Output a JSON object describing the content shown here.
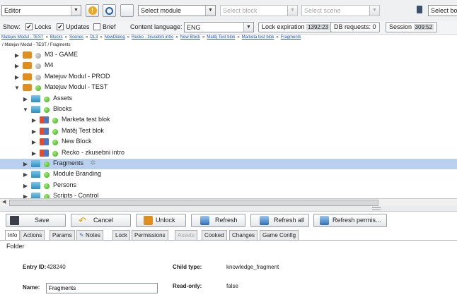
{
  "toolbar": {
    "mode_select": "Editor",
    "module_select": "Select module",
    "block_select": "Select block",
    "scene_select": "Select scene",
    "block_right_button": "Select bo"
  },
  "options": {
    "show_label": "Show:",
    "locks_label": "Locks",
    "locks_checked": true,
    "updates_label": "Updates",
    "updates_checked": true,
    "brief_label": "Brief",
    "brief_checked": false,
    "content_language_label": "Content language:",
    "content_language_value": "ENG",
    "lock_expiration_label": "Lock expiration",
    "lock_expiration_value": "1392:23",
    "db_requests_label": "DB requests:",
    "db_requests_value": "0",
    "session_label": "Session",
    "session_value": "309:52"
  },
  "breadcrumb": [
    "Matejuv Modul - TEST",
    "Blocks",
    "Scenes",
    "DL3",
    "NewDialog",
    "Recko - zkusebni intro",
    "New Block",
    "Matěj Test blok",
    "Marketa test blok",
    "Fragments"
  ],
  "breadcrumb_sep": "»",
  "path_text": "/  Matejuv Modul - TEST  /  Fragments",
  "tree": [
    {
      "label": "M3 - GAME",
      "toggle": "▶",
      "icon": "lock-icon",
      "dot": "grey"
    },
    {
      "label": "M4",
      "toggle": "▶",
      "icon": "lock-icon",
      "dot": "grey"
    },
    {
      "label": "Matejuv Modul - PROD",
      "toggle": "▶",
      "icon": "lock-icon",
      "dot": "grey"
    },
    {
      "label": "Matejuv Modul - TEST",
      "toggle": "▼",
      "icon": "lock-icon",
      "dot": "green"
    },
    {
      "label": "Assets",
      "toggle": "▶",
      "icon": "folder-icon",
      "dot": "green"
    },
    {
      "label": "Blocks",
      "toggle": "▼",
      "icon": "folder-icon",
      "dot": "green"
    },
    {
      "label": "Marketa test blok",
      "toggle": "▶",
      "icon": "block-icon",
      "dot": "green"
    },
    {
      "label": "Matěj Test blok",
      "toggle": "▶",
      "icon": "block-icon",
      "dot": "green"
    },
    {
      "label": "New Block",
      "toggle": "▶",
      "icon": "block-icon",
      "dot": "green"
    },
    {
      "label": "Recko - zkusebni intro",
      "toggle": "▶",
      "icon": "block-icon",
      "dot": "green"
    },
    {
      "label": "Fragments",
      "toggle": "▶",
      "icon": "folder-icon",
      "dot": "green",
      "selected": true
    },
    {
      "label": "Module Branding",
      "toggle": "▶",
      "icon": "folder-icon",
      "dot": "green"
    },
    {
      "label": "Persons",
      "toggle": "▶",
      "icon": "folder-icon",
      "dot": "green"
    },
    {
      "label": "Scripts - Control",
      "toggle": "▶",
      "icon": "folder-icon",
      "dot": "green"
    }
  ],
  "actions": {
    "save": "Save",
    "cancel": "Cancel",
    "unlock": "Unlock",
    "refresh": "Refresh",
    "refresh_all": "Refresh all",
    "refresh_perms": "Refresh permis..."
  },
  "tabs": [
    "Info",
    "Actions",
    "Params",
    "Notes",
    "Lock",
    "Permissions",
    "Assets",
    "Cooked",
    "Changes",
    "Game Config"
  ],
  "tabs_disabled": [
    "Assets"
  ],
  "tab_active": "Info",
  "details": {
    "type_title": "Folder",
    "entry_id_label": "Entry ID:",
    "entry_id_value": "428240",
    "child_type_label": "Child type:",
    "child_type_value": "knowledge_fragment",
    "name_label": "Name:",
    "name_value": "Fragments",
    "read_only_label": "Read-only:",
    "read_only_value": "false"
  },
  "colors": {
    "selection": "#b9d0ee",
    "link": "#1a4fb3",
    "status_green": "#3ba51a"
  }
}
